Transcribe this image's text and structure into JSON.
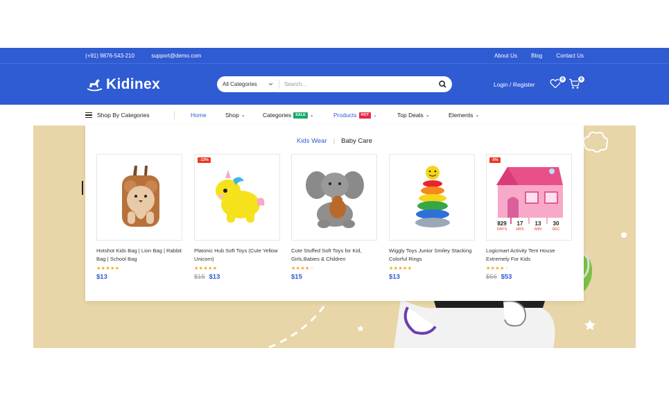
{
  "topbar": {
    "phone": "(+91) 9876-543-210",
    "email": "support@demo.com",
    "links": [
      "About Us",
      "Blog",
      "Contact Us"
    ]
  },
  "header": {
    "brand": "Kidinex",
    "search": {
      "category": "All Categories",
      "placeholder": "Search..."
    },
    "login": "Login / Register",
    "wishlist_count": "0",
    "cart_count": "0"
  },
  "nav": {
    "shop_by": "Shop By Categories",
    "items": [
      {
        "label": "Home"
      },
      {
        "label": "Shop"
      },
      {
        "label": "Categories",
        "tag": "SALE"
      },
      {
        "label": "Products",
        "tag": "HOT"
      },
      {
        "label": "Top Deals"
      },
      {
        "label": "Elements"
      }
    ]
  },
  "colors": {
    "primary": "#2f5bd3",
    "sale": "#1aa86b",
    "hot": "#e8264a",
    "discount": "#e8381f",
    "star": "#f0a818",
    "hero_bg": "#e8d5a8"
  },
  "dropdown": {
    "tabs": [
      "Kids Wear",
      "Baby Care"
    ],
    "products": [
      {
        "title": "Hotshot Kids Bag | Lion Bag | Rabbit Bag | School Bag",
        "rating": 5,
        "price": "$13",
        "old_price": "",
        "discount": ""
      },
      {
        "title": "Platonic Hub Soft Toys (Cute Yellow Unicorn)",
        "rating": 5,
        "price": "$13",
        "old_price": "$15",
        "discount": "-13%"
      },
      {
        "title": "Cute Stuffed Soft Toys for Kid, Girls,Babies & Children",
        "rating": 4,
        "price": "$15",
        "old_price": "",
        "discount": ""
      },
      {
        "title": "Wiggly Toys Junior Smiley Stacking Colorful Rings",
        "rating": 5,
        "price": "$13",
        "old_price": "",
        "discount": ""
      },
      {
        "title": "Logicmart Activity Tent House Extremely For Kids",
        "rating": 4,
        "price": "$53",
        "old_price": "$56",
        "discount": "-5%",
        "countdown": [
          {
            "value": "829",
            "unit": "DAYS"
          },
          {
            "value": "17",
            "unit": "HRS"
          },
          {
            "value": "13",
            "unit": "MIN"
          },
          {
            "value": "30",
            "unit": "SEC"
          }
        ]
      }
    ]
  }
}
